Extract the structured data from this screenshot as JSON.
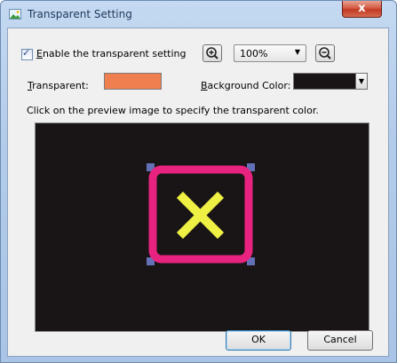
{
  "window": {
    "title": "Transparent Setting",
    "close_glyph": "x"
  },
  "options": {
    "enable_label": "Enable the transparent setting",
    "enable_mnemonic": "E",
    "enable_checked": true,
    "zoom_value": "100%",
    "zoom_in_icon": "zoom-in-icon",
    "zoom_out_icon": "zoom-out-icon"
  },
  "colors": {
    "transparent_label": "Transparent:",
    "transparent_mnemonic": "T",
    "transparent_color": "#f07f4f",
    "background_label": "Background Color:",
    "background_mnemonic": "B",
    "background_color": "#191516"
  },
  "instruction": "Click on the preview image to specify the transparent color.",
  "preview": {
    "frame_color": "#e8237f",
    "mark_color": "#eef043",
    "corner_color": "#6470b5"
  },
  "buttons": {
    "ok": "OK",
    "cancel": "Cancel"
  }
}
